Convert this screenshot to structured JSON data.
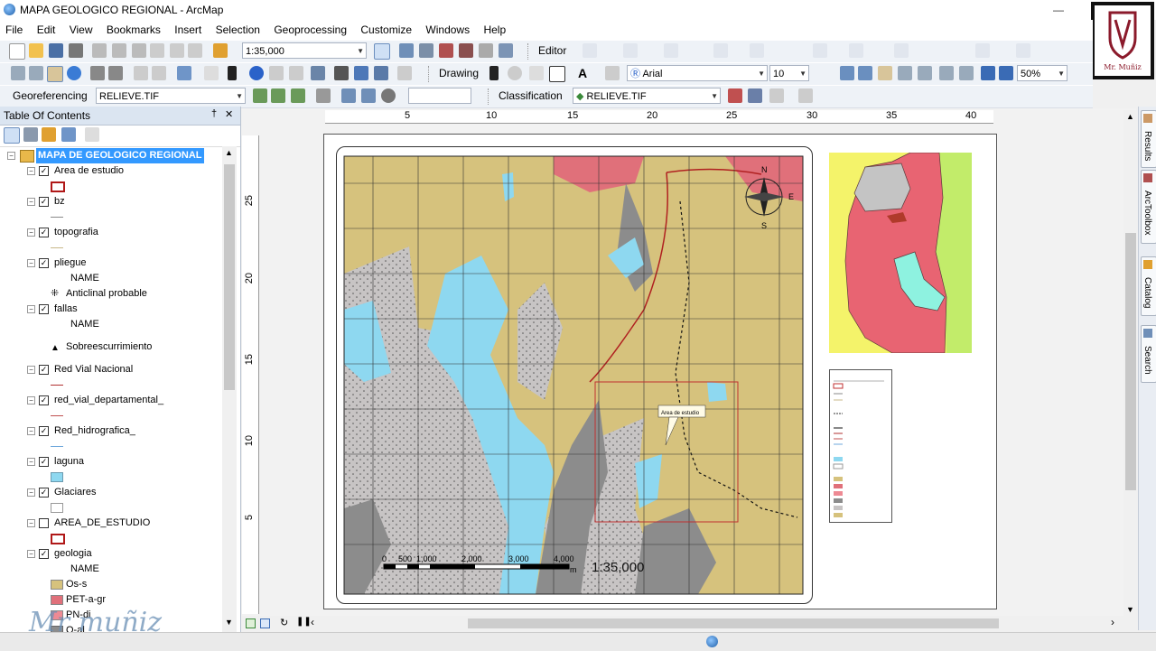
{
  "window": {
    "title": "MAPA GEOLOGICO REGIONAL - ArcMap"
  },
  "menu": [
    "File",
    "Edit",
    "View",
    "Bookmarks",
    "Insert",
    "Selection",
    "Geoprocessing",
    "Customize",
    "Windows",
    "Help"
  ],
  "toolbar": {
    "scale_value": "1:35,000",
    "editor_label": "Editor",
    "drawing_label": "Drawing",
    "font_name": "Arial",
    "font_size": "10",
    "zoom_percent": "50%",
    "georeferencing_label": "Georeferencing",
    "georef_layer": "RELIEVE.TIF",
    "classification_label": "Classification",
    "classification_layer": "RELIEVE.TIF"
  },
  "toc": {
    "title": "Table Of Contents",
    "pin": "†",
    "close": "✕",
    "dataframe": "MAPA DE GEOLOGICO REGIONAL",
    "layers": [
      {
        "name": "Area de estudio",
        "checked": true
      },
      {
        "name": "bz",
        "checked": true
      },
      {
        "name": "topografia",
        "checked": true
      },
      {
        "name": "pliegue",
        "checked": true,
        "field": "NAME",
        "class": "Anticlinal probable"
      },
      {
        "name": "fallas",
        "checked": true,
        "field": "NAME",
        "class": "Sobreescurrimiento"
      },
      {
        "name": "Red Vial Nacional",
        "checked": true
      },
      {
        "name": "red_vial_departamental_",
        "checked": true
      },
      {
        "name": "Red_hidrografica_",
        "checked": true
      },
      {
        "name": "laguna",
        "checked": true
      },
      {
        "name": "Glaciares",
        "checked": true
      },
      {
        "name": "AREA_DE_ESTUDIO",
        "checked": false
      },
      {
        "name": "geologia",
        "checked": true,
        "field": "NAME",
        "classes": [
          "Os-s",
          "PET-a-gr",
          "PN-di",
          "Q-al"
        ]
      }
    ]
  },
  "map": {
    "scale_text": "1:35,000",
    "scalebar_labels": [
      "0",
      "500",
      "1,000",
      "2,000",
      "3,000",
      "4,000"
    ],
    "scalebar_unit": "m",
    "study_area_callout": "Area de estudio",
    "north": "N",
    "south": "S",
    "east": "E"
  },
  "ruler_h": [
    "5",
    "10",
    "15",
    "20",
    "25",
    "30",
    "35",
    "40"
  ],
  "ruler_v": [
    "25",
    "20",
    "15",
    "10",
    "5"
  ],
  "right_tabs": [
    "Results",
    "ArcToolbox",
    "Catalog",
    "Search"
  ],
  "watermark": "Mr muñiz",
  "logo_text": "Mr. Muñiz",
  "colors": {
    "water": "#8ed8f0",
    "granite": "#c7c4c4",
    "sediment": "#d6c27d",
    "pet": "#e0707a",
    "gray": "#8c8c8c",
    "grid": "#333333",
    "toc_select": "#3399ff"
  }
}
